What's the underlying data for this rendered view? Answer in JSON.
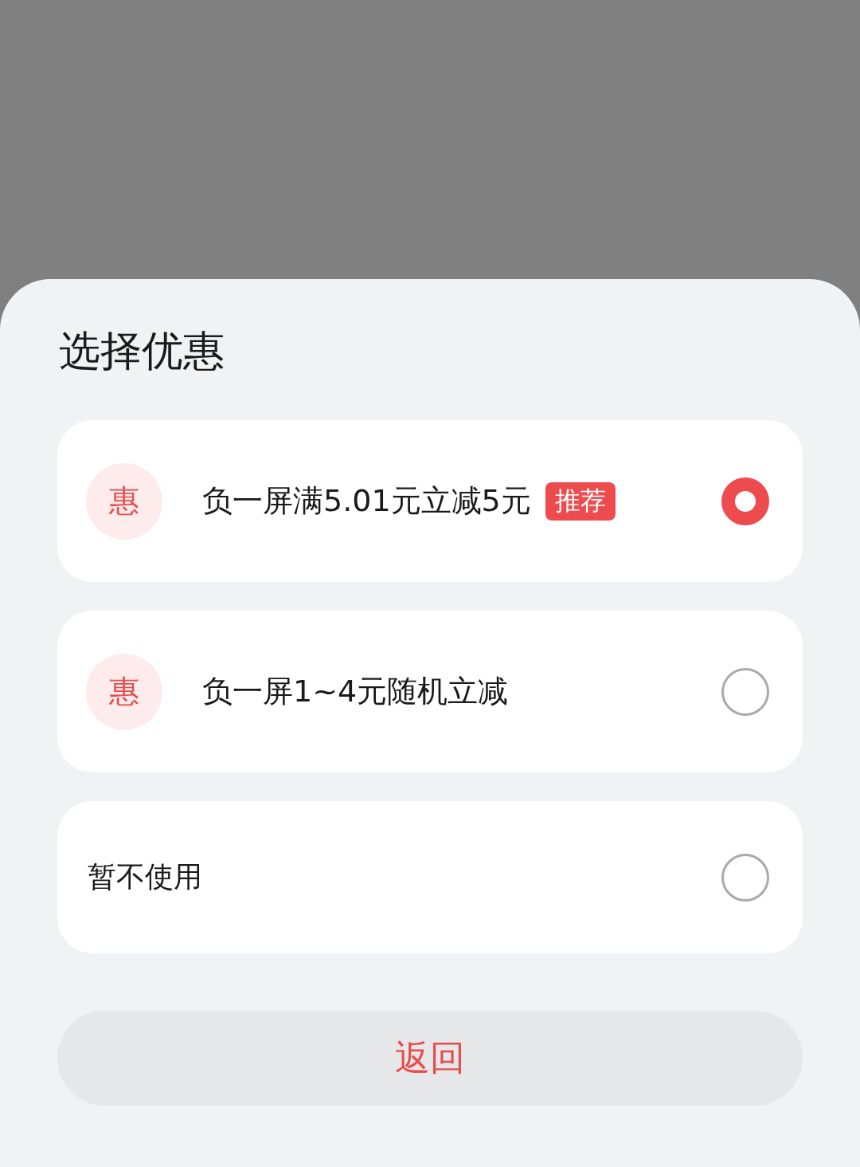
{
  "title": "选择优惠",
  "options": [
    {
      "kind": "coupon",
      "icon": "惠",
      "label": "负一屏满5.01元立减5元",
      "badge": "推荐",
      "selected": true
    },
    {
      "kind": "coupon",
      "icon": "惠",
      "label": "负一屏1~4元随机立减",
      "selected": false
    },
    {
      "kind": "plain",
      "label": "暂不使用",
      "selected": false
    }
  ],
  "back_button": "返回"
}
